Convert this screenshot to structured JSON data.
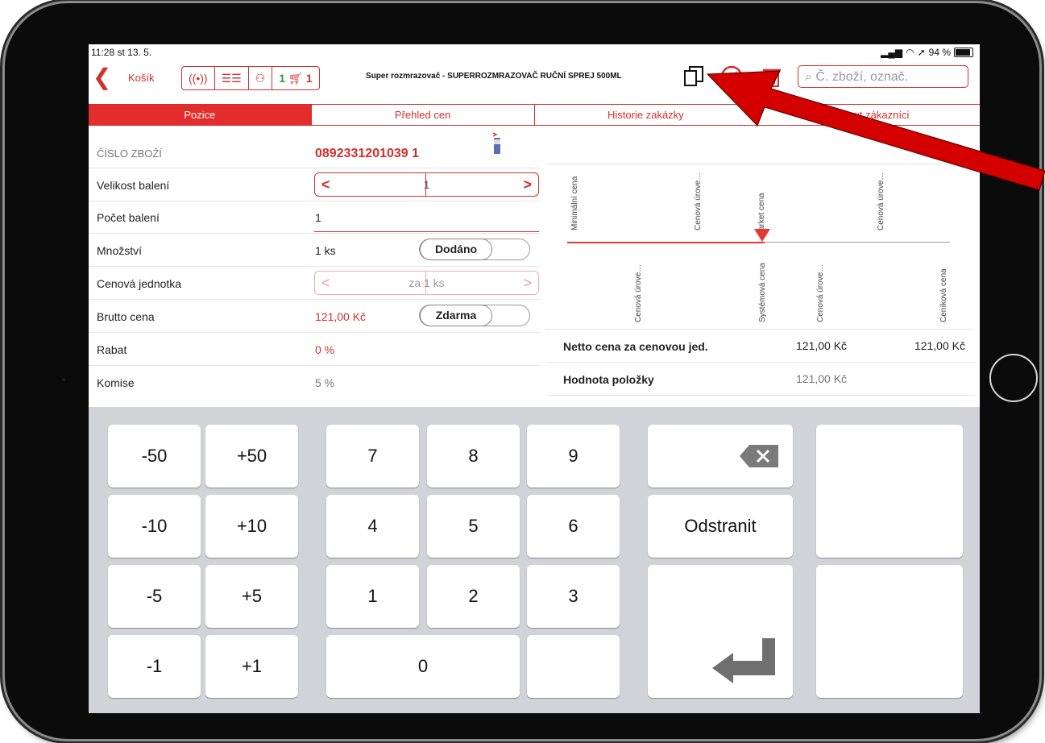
{
  "status_bar": {
    "time": "11:28  st 13. 5.",
    "battery": "94 %"
  },
  "toolbar": {
    "back_label": "Košík",
    "cart_left": "1",
    "cart_right": "1",
    "product_title": "Super rozmrazovač - SUPERROZMRAZOVAČ RUČNÍ SPREJ 500ML",
    "search_placeholder": "Č. zboží, označ."
  },
  "tabs": [
    "Pozice",
    "Přehled cen",
    "Historie zakázky",
    "Infotext zákazníci"
  ],
  "form": {
    "item_number_label": "ČÍSLO ZBOŽÍ",
    "item_number": "0892331201039  1",
    "pack_size_label": "Velikost balení",
    "pack_size": "1",
    "pack_count_label": "Počet balení",
    "pack_count": "1",
    "quantity_label": "Množství",
    "quantity": "1 ks",
    "delivered_label": "Dodáno",
    "price_unit_label": "Cenová jednotka",
    "price_unit": "za 1 ks",
    "gross_price_label": "Brutto cena",
    "gross_price": "121,00 Kč",
    "free_label": "Zdarma",
    "discount_label": "Rabat",
    "discount": "0 %",
    "commission_label": "Komise",
    "commission": "5 %"
  },
  "price_chart": {
    "top_labels": [
      "Minimální cena",
      "Cenová úrove…",
      "arket cena",
      "Cenová úrove…"
    ],
    "bottom_labels": [
      "Cenová úrove…",
      "Systémová cena",
      "Cenová úrove…",
      "Ceníková cena"
    ]
  },
  "info": {
    "net_label": "Netto cena za cenovou jed.",
    "net_value1": "121,00 Kč",
    "net_value2": "121,00 Kč",
    "item_value_label": "Hodnota položky",
    "item_value": "121,00 Kč"
  },
  "keypad": {
    "k_m50": "-50",
    "k_p50": "+50",
    "k_m10": "-10",
    "k_p10": "+10",
    "k_m5": "-5",
    "k_p5": "+5",
    "k_m1": "-1",
    "k_p1": "+1",
    "k7": "7",
    "k8": "8",
    "k9": "9",
    "k4": "4",
    "k5": "5",
    "k6": "6",
    "k1": "1",
    "k2": "2",
    "k3": "3",
    "k0": "0",
    "remove": "Odstranit"
  },
  "colors": {
    "accent": "#d32f2f",
    "ok": "#2e9b2e",
    "keypad_bg": "#d1d3d9"
  }
}
